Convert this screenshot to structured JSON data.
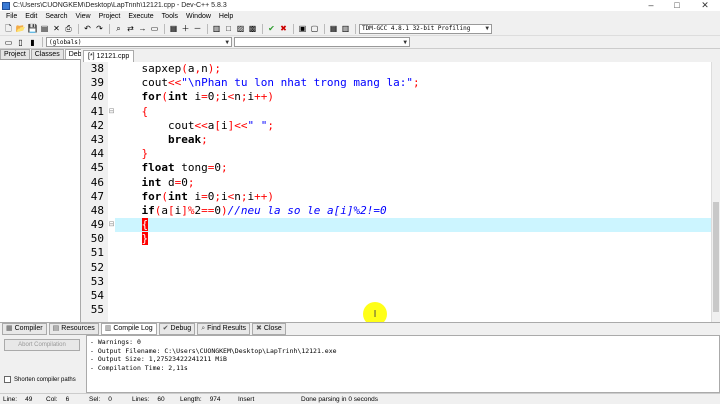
{
  "window": {
    "title": "C:\\Users\\CUONGKEM\\Desktop\\LapTrinh\\12121.cpp - Dev-C++ 5.8.3",
    "minimize": "–",
    "maximize": "□",
    "close": "✕"
  },
  "menu": [
    "File",
    "Edit",
    "Search",
    "View",
    "Project",
    "Execute",
    "Tools",
    "Window",
    "Help"
  ],
  "toolbar": {
    "compiler_select": "TDM-GCC 4.8.1 32-bit Profiling",
    "scope_select": "(globals)",
    "symbol_select": ""
  },
  "left_tabs": [
    "Project",
    "Classes",
    "Debug"
  ],
  "file_tab": "[*] 12121.cpp",
  "editor": {
    "current_line": 49,
    "lines": [
      {
        "n": "38",
        "fold": "",
        "html": "    sapxep(a,n);"
      },
      {
        "n": "39",
        "fold": "",
        "html": "    cout<<\"\\nPhan tu lon nhat trong mang la:\";"
      },
      {
        "n": "40",
        "fold": "",
        "html": "    for(int i=0;i<n;i++)"
      },
      {
        "n": "41",
        "fold": "⊟",
        "html": "    {"
      },
      {
        "n": "42",
        "fold": "",
        "html": "        cout<<a[i]<<\" \";"
      },
      {
        "n": "43",
        "fold": "",
        "html": "        break;"
      },
      {
        "n": "44",
        "fold": "",
        "html": "    }"
      },
      {
        "n": "45",
        "fold": "",
        "html": "    float tong=0;"
      },
      {
        "n": "46",
        "fold": "",
        "html": "    int d=0;"
      },
      {
        "n": "47",
        "fold": "",
        "html": "    for(int i=0;i<n;i++)"
      },
      {
        "n": "48",
        "fold": "",
        "html": "    if(a[i]%2==0)//neu la so le a[i]%2!=0"
      },
      {
        "n": "49",
        "fold": "⊟",
        "html": "    {"
      },
      {
        "n": "50",
        "fold": "",
        "html": "    }"
      },
      {
        "n": "51",
        "fold": "",
        "html": ""
      },
      {
        "n": "52",
        "fold": "",
        "html": ""
      },
      {
        "n": "53",
        "fold": "",
        "html": ""
      },
      {
        "n": "54",
        "fold": "",
        "html": ""
      },
      {
        "n": "55",
        "fold": "",
        "html": ""
      }
    ]
  },
  "bottom_tabs": [
    {
      "label": "Compiler",
      "icon": "▦",
      "active": false
    },
    {
      "label": "Resources",
      "icon": "▤",
      "active": false
    },
    {
      "label": "Compile Log",
      "icon": "▥",
      "active": true
    },
    {
      "label": "Debug",
      "icon": "✔",
      "active": false
    },
    {
      "label": "Find Results",
      "icon": "⌕",
      "active": false
    },
    {
      "label": "Close",
      "icon": "✖",
      "active": false
    }
  ],
  "bottom": {
    "abort_label": "Abort Compilation",
    "shorten_label": "Shorten compiler paths",
    "log": [
      "- Warnings: 0",
      "- Output Filename: C:\\Users\\CUONGKEM\\Desktop\\LapTrinh\\12121.exe",
      "- Output Size: 1,27523422241211 MiB",
      "- Compilation Time: 2,11s"
    ]
  },
  "status": [
    {
      "label": "Line:",
      "value": "49"
    },
    {
      "label": "Col:",
      "value": "6"
    },
    {
      "label": "Sel:",
      "value": "0"
    },
    {
      "label": "Lines:",
      "value": "60"
    },
    {
      "label": "Length:",
      "value": "974"
    },
    {
      "label": "Insert",
      "value": ""
    },
    {
      "label": "Done parsing in 0 seconds",
      "value": ""
    }
  ]
}
